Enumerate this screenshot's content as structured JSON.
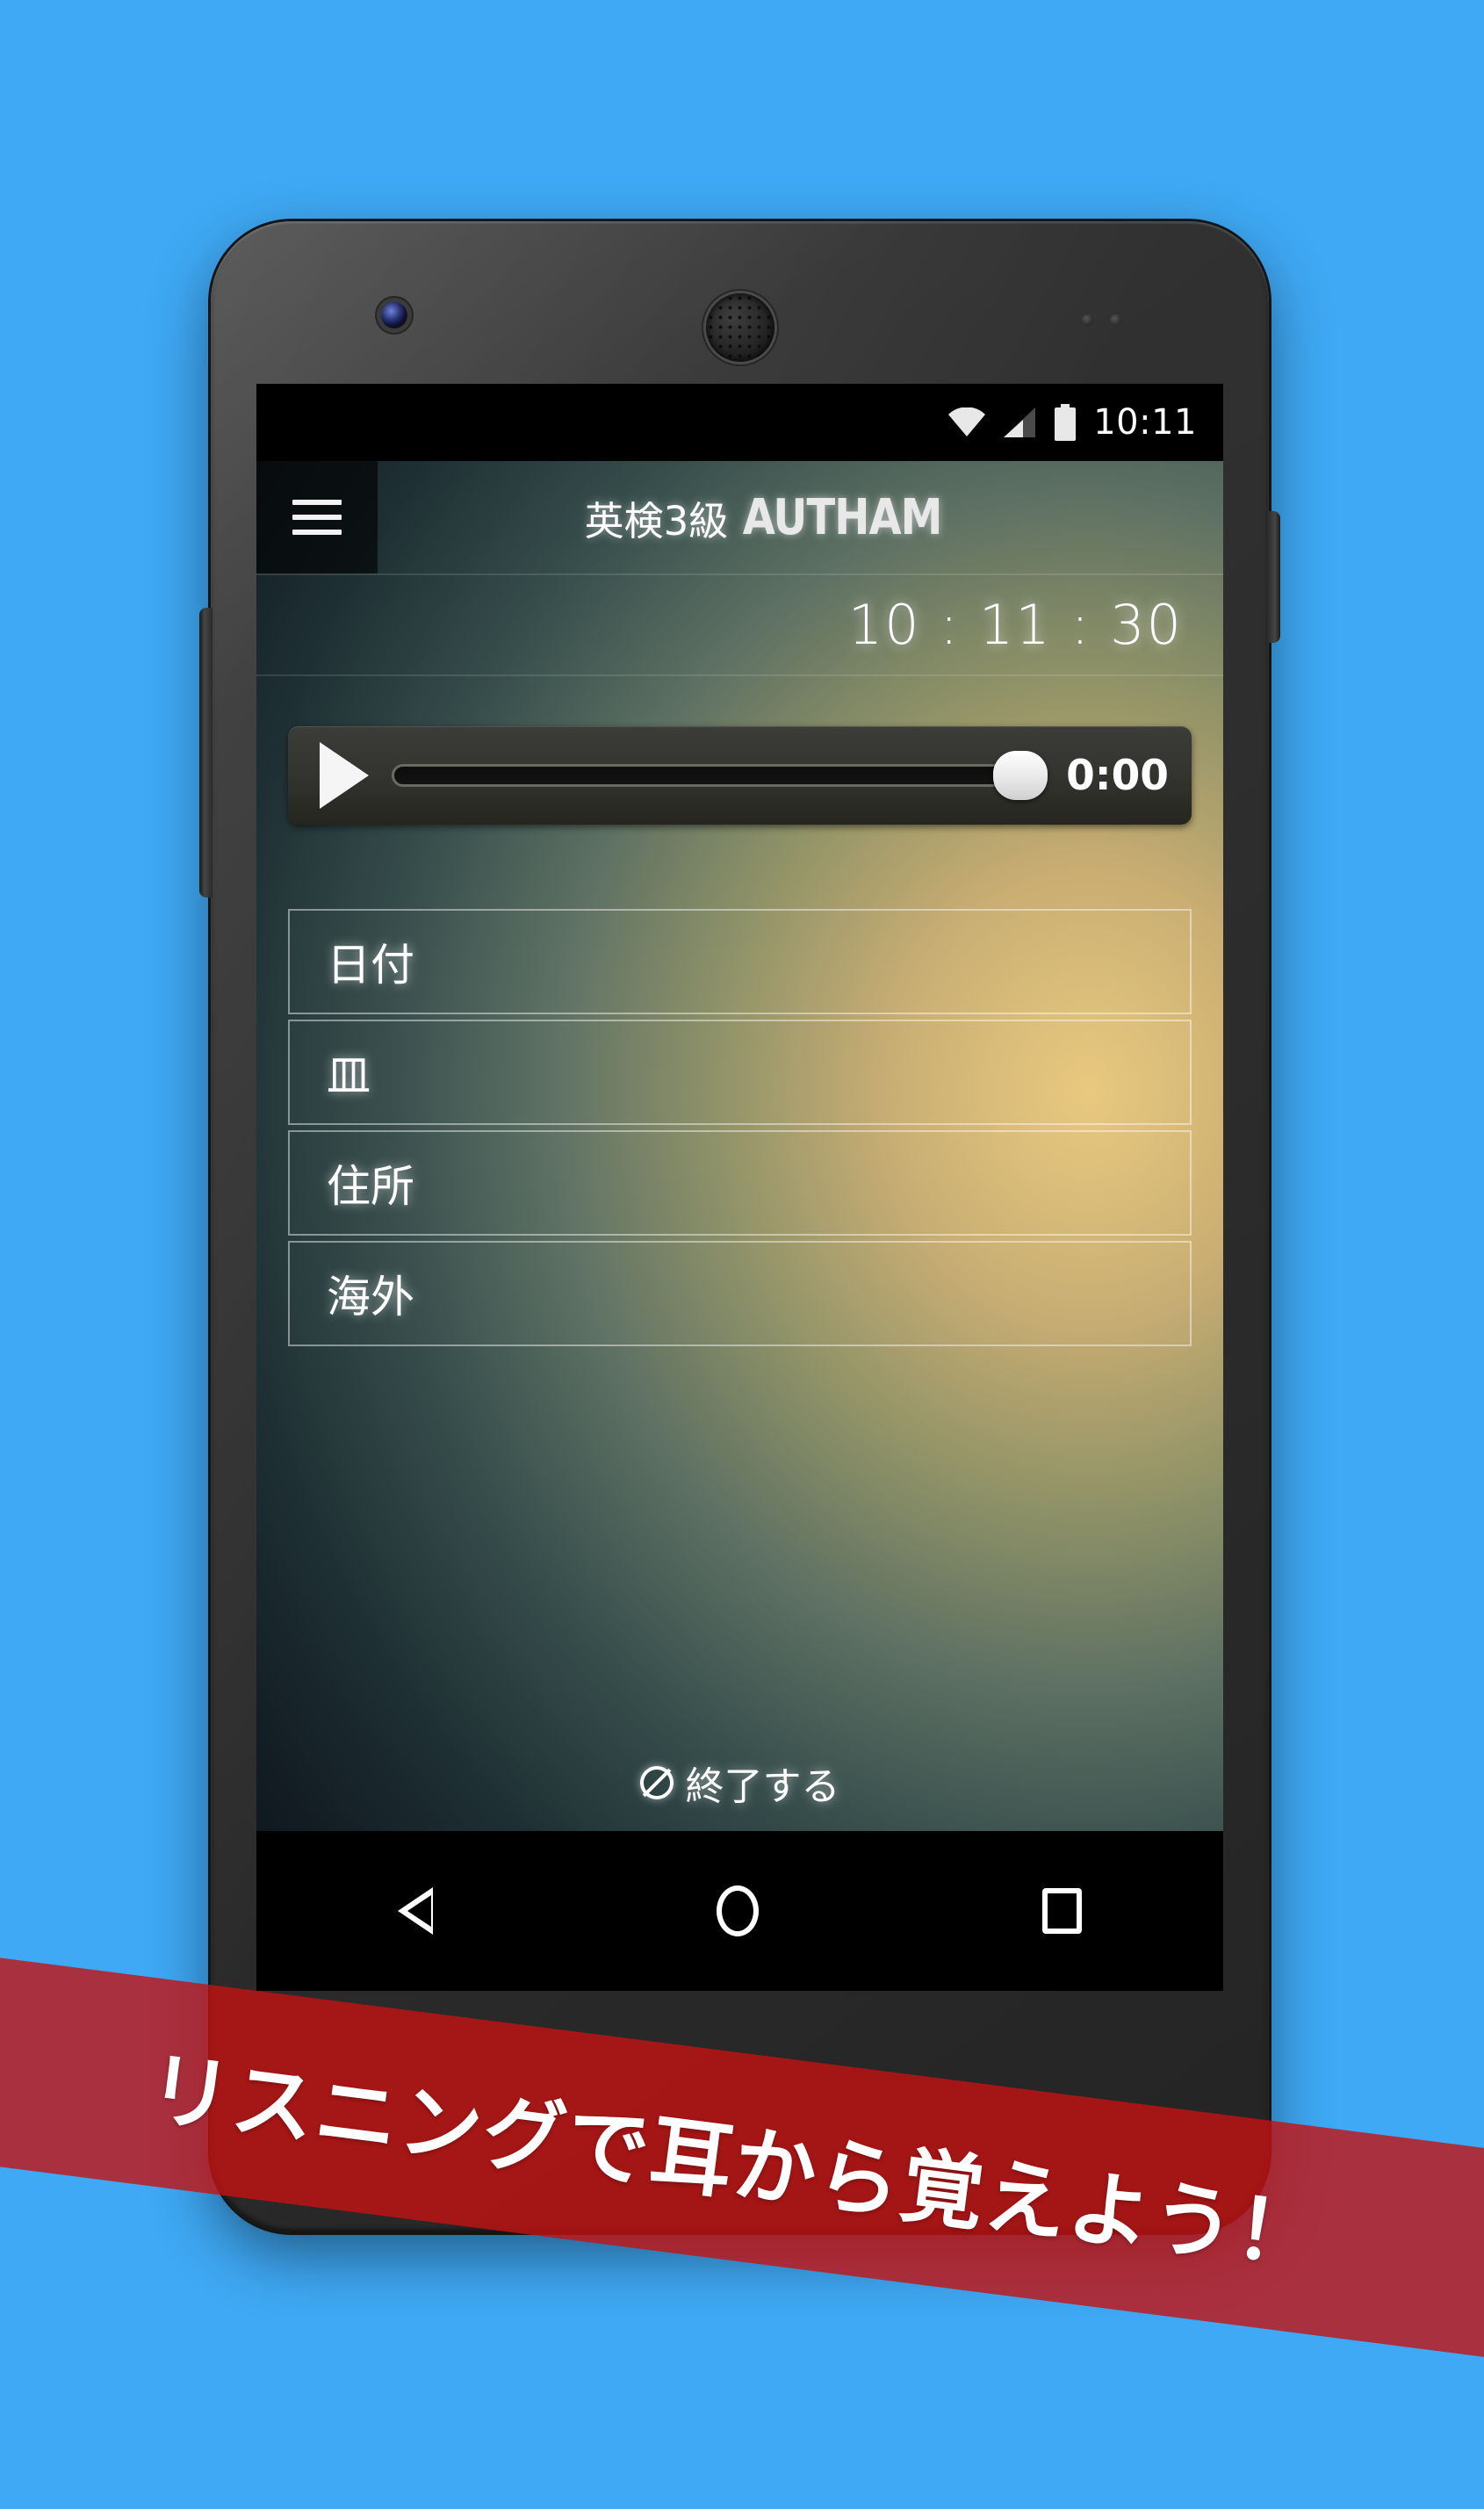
{
  "background": {
    "color": "#3fa9f5"
  },
  "device": {
    "name": "android-phone",
    "icons": {
      "front_camera": "front-camera-icon",
      "earpiece": "speaker-grille-icon",
      "power_button": "power-button",
      "volume_button": "volume-button"
    }
  },
  "statusbar": {
    "wifi_icon": "wifi-icon",
    "signal_icon": "cellular-signal-icon",
    "battery_icon": "battery-full-icon",
    "clock": "10:11"
  },
  "appbar": {
    "menu_icon": "hamburger-menu-icon",
    "title": "英検3級",
    "logo": "AUTHAM"
  },
  "countdown": {
    "value": "10 : 11 : 30"
  },
  "player": {
    "play_icon": "play-icon",
    "seek_label": "seek-bar",
    "progress_percent": 100,
    "time": "0:00"
  },
  "options": [
    {
      "label": "日付"
    },
    {
      "label": "皿"
    },
    {
      "label": "住所"
    },
    {
      "label": "海外"
    }
  ],
  "quit": {
    "icon": "no-entry-icon",
    "label": "終了する"
  },
  "navbar": {
    "back_icon": "nav-back-icon",
    "home_icon": "nav-home-icon",
    "recents_icon": "nav-recents-icon"
  },
  "banner": {
    "text": "リスニングで耳から覚えよう！",
    "color": "#c41212"
  }
}
